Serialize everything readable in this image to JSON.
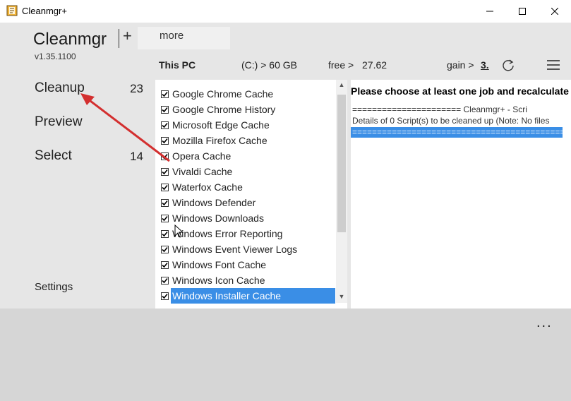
{
  "window": {
    "title": "Cleanmgr+",
    "controls": [
      "minimize",
      "maximize",
      "close"
    ]
  },
  "tabs": {
    "title": "Cleanmgr",
    "plus": "+",
    "more": "more"
  },
  "version": "v1.35.1100",
  "nav": {
    "items": [
      {
        "label": "Cleanup",
        "count": "23"
      },
      {
        "label": "Preview",
        "count": ""
      },
      {
        "label": "Select",
        "count": "14"
      }
    ],
    "settings": "Settings"
  },
  "info": {
    "pc": "This PC",
    "drive": "(C:) > 60 GB",
    "free_label": "free >",
    "free_value": "27.62",
    "gain_label": "gain >",
    "gain_value": "3.",
    "refresh_icon": "refresh-icon",
    "menu_icon": "hamburger-menu-icon"
  },
  "list": {
    "items": [
      {
        "label": "Google Chrome Cache",
        "checked": true
      },
      {
        "label": "Google Chrome History",
        "checked": true
      },
      {
        "label": "Microsoft Edge Cache",
        "checked": true
      },
      {
        "label": "Mozilla Firefox Cache",
        "checked": true
      },
      {
        "label": "Opera Cache",
        "checked": true
      },
      {
        "label": "Vivaldi Cache",
        "checked": true
      },
      {
        "label": "Waterfox Cache",
        "checked": true
      },
      {
        "label": "Windows Defender",
        "checked": true
      },
      {
        "label": "Windows Downloads",
        "checked": true
      },
      {
        "label": "Windows Error Reporting",
        "checked": true
      },
      {
        "label": "Windows Event Viewer Logs",
        "checked": true
      },
      {
        "label": "Windows Font Cache",
        "checked": true
      },
      {
        "label": "Windows Icon Cache",
        "checked": true
      },
      {
        "label": "Windows Installer Cache",
        "checked": true,
        "selected": true
      }
    ]
  },
  "output": {
    "heading": "Please choose at least one job and recalculate",
    "lines": [
      "====================== Cleanmgr+ - Scri",
      "Details of 0 Script(s) to be cleaned up (Note: No files"
    ],
    "selected_line": "==============================================="
  },
  "footer": {
    "dots": "..."
  },
  "colors": {
    "accent": "#3a8ee6",
    "body_bg": "#e6e6e6",
    "footer_bg": "#d6d6d6",
    "annotation_arrow": "#d32f2f"
  }
}
